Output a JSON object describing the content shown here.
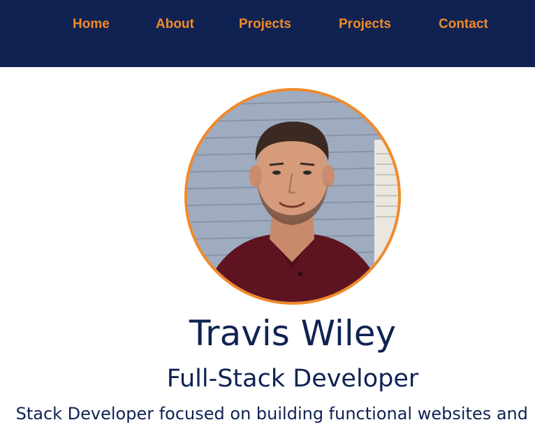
{
  "nav": {
    "items": [
      {
        "label": "Home"
      },
      {
        "label": "About"
      },
      {
        "label": "Projects"
      },
      {
        "label": "Projects"
      },
      {
        "label": "Contact"
      }
    ]
  },
  "profile": {
    "photo": "profile-photo",
    "name": "Travis Wiley",
    "title": "Full-Stack Developer",
    "bio_visible": "Stack Developer focused on building functional websites and"
  },
  "colors": {
    "nav_bg": "#0f2252",
    "accent": "#f08a2a",
    "text": "#0f2252"
  }
}
